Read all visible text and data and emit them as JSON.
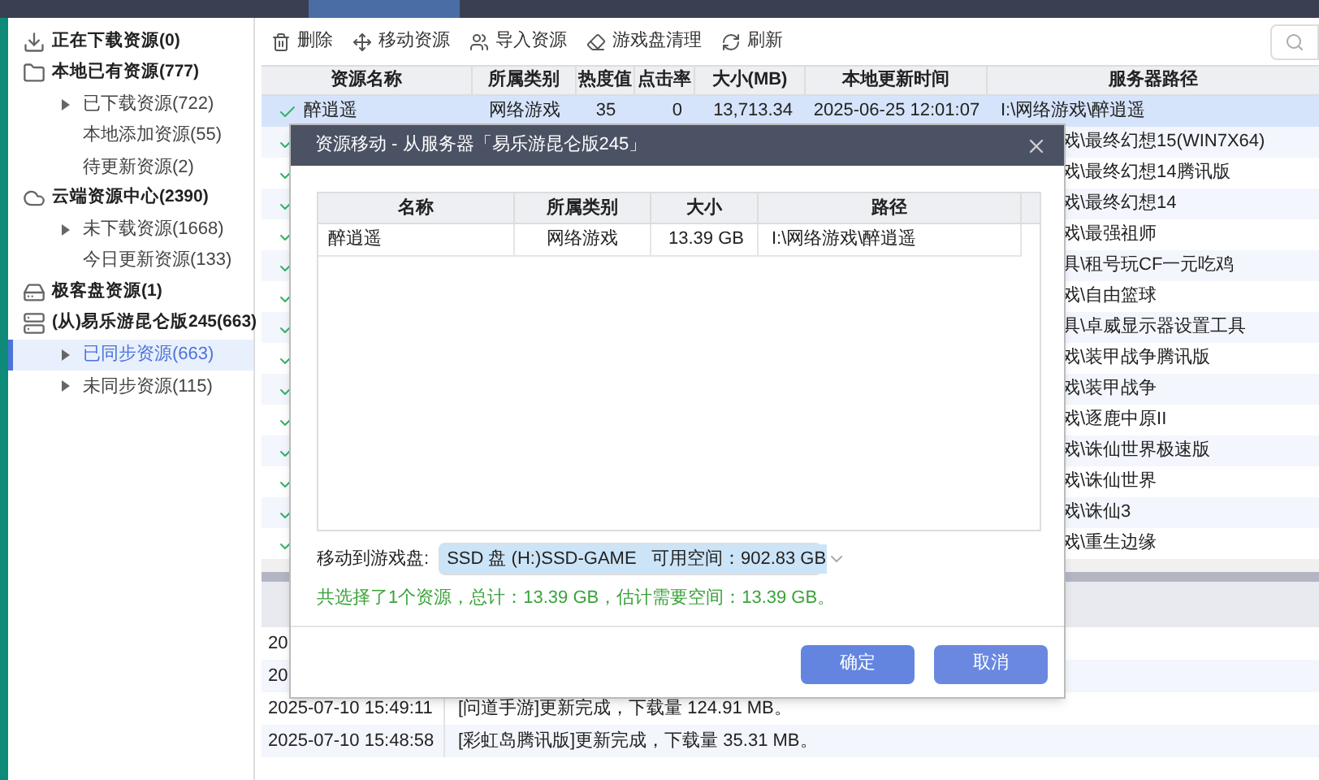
{
  "toolbar": [
    {
      "label": "删除",
      "kind": "delete"
    },
    {
      "label": "移动资源",
      "kind": "move"
    },
    {
      "label": "导入资源",
      "kind": "import"
    },
    {
      "label": "游戏盘清理",
      "kind": "clean"
    },
    {
      "label": "刷新",
      "kind": "refresh"
    }
  ],
  "sidebar": {
    "items": [
      {
        "label": "正在下载资源(0)",
        "kind": "download"
      },
      {
        "label": "本地已有资源(777)",
        "kind": "folder",
        "children": [
          {
            "label": "已下载资源(722)",
            "expandable": true,
            "selected": false
          },
          {
            "label": "本地添加资源(55)",
            "expandable": false,
            "selected": false
          },
          {
            "label": "待更新资源(2)",
            "expandable": false,
            "selected": false
          }
        ]
      },
      {
        "label": "云端资源中心(2390)",
        "kind": "cloud",
        "children": [
          {
            "label": "未下载资源(1668)",
            "expandable": true,
            "selected": false
          },
          {
            "label": "今日更新资源(133)",
            "expandable": false,
            "selected": false
          }
        ]
      },
      {
        "label": "极客盘资源(1)",
        "kind": "disk"
      },
      {
        "label": "(从)易乐游昆仑版245(663)",
        "kind": "server",
        "children": [
          {
            "label": "已同步资源(663)",
            "expandable": true,
            "selected": true
          },
          {
            "label": "未同步资源(115)",
            "expandable": true,
            "selected": false
          }
        ]
      }
    ]
  },
  "table": {
    "columns": [
      "资源名称",
      "所属类别",
      "热度值",
      "点击率",
      "大小(MB)",
      "本地更新时间",
      "服务器路径"
    ],
    "rows": [
      {
        "kind": "full",
        "checked": true,
        "selected": true,
        "cells": [
          "醉逍遥",
          "网络游戏",
          "35",
          "0",
          "13,713.34",
          "2025-06-25 12:01:07",
          "I:\\网络游戏\\醉逍遥"
        ]
      },
      {
        "kind": "covered",
        "checked": true,
        "selected": false,
        "path": "戏\\最终幻想15(WIN7X64)"
      },
      {
        "kind": "covered",
        "checked": true,
        "selected": false,
        "path": "戏\\最终幻想14腾讯版"
      },
      {
        "kind": "covered",
        "checked": true,
        "selected": false,
        "path": "戏\\最终幻想14"
      },
      {
        "kind": "covered",
        "checked": true,
        "selected": false,
        "path": "戏\\最强祖师"
      },
      {
        "kind": "covered",
        "checked": true,
        "selected": false,
        "path": "具\\租号玩CF一元吃鸡"
      },
      {
        "kind": "covered",
        "checked": true,
        "selected": false,
        "path": "戏\\自由篮球"
      },
      {
        "kind": "covered",
        "checked": true,
        "selected": false,
        "path": "具\\卓威显示器设置工具"
      },
      {
        "kind": "covered",
        "checked": true,
        "selected": false,
        "path": "戏\\装甲战争腾讯版"
      },
      {
        "kind": "covered",
        "checked": true,
        "selected": false,
        "path": "戏\\装甲战争"
      },
      {
        "kind": "covered",
        "checked": true,
        "selected": false,
        "path": "戏\\逐鹿中原II"
      },
      {
        "kind": "covered",
        "checked": true,
        "selected": false,
        "path": "戏\\诛仙世界极速版"
      },
      {
        "kind": "covered",
        "checked": true,
        "selected": false,
        "path": "戏\\诛仙世界"
      },
      {
        "kind": "covered",
        "checked": true,
        "selected": false,
        "path": "戏\\诛仙3"
      },
      {
        "kind": "covered",
        "checked": true,
        "selected": false,
        "path": "戏\\重生边缘"
      }
    ]
  },
  "log": {
    "rows": [
      {
        "time": "20"
      },
      {
        "time": "20"
      },
      {
        "time": "2025-07-10 15:49:11",
        "message": "[问道手游]更新完成，下载量 124.91 MB。"
      },
      {
        "time": "2025-07-10 15:48:58",
        "message": "[彩虹岛腾讯版]更新完成，下载量 35.31 MB。"
      }
    ]
  },
  "dialog": {
    "title": "资源移动 - 从服务器「易乐游昆仑版245」",
    "columns": [
      "名称",
      "所属类别",
      "大小",
      "路径"
    ],
    "rows": [
      [
        "醉逍遥",
        "网络游戏",
        "13.39 GB",
        "I:\\网络游戏\\醉逍遥"
      ]
    ],
    "target_label": "移动到游戏盘:",
    "target_value": "SSD 盘 (H:)SSD-GAME   可用空间：902.83 GB",
    "summary": "共选择了1个资源，总计：13.39 GB，估计需要空间：13.39 GB。",
    "buttons": [
      {
        "label": "确定",
        "kind": "ok"
      },
      {
        "label": "取消",
        "kind": "cancel"
      }
    ]
  }
}
